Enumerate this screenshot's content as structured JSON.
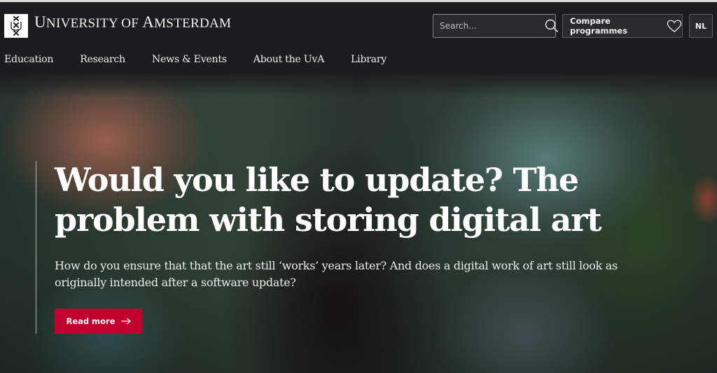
{
  "header": {
    "brand": {
      "first": "U",
      "rest1": "NIVERSITY OF ",
      "second": "A",
      "rest2": "MSTERDAM",
      "full": "University of Amsterdam"
    },
    "logo_icon": "uva-crest-icon",
    "search": {
      "placeholder": "Search...",
      "value": "",
      "icon": "search-icon"
    },
    "compare": {
      "label": "Compare programmes",
      "icon": "heart-icon"
    },
    "language": {
      "label": "NL"
    }
  },
  "nav": {
    "items": [
      {
        "label": "Education"
      },
      {
        "label": "Research"
      },
      {
        "label": "News & Events"
      },
      {
        "label": "About the UvA"
      },
      {
        "label": "Library"
      }
    ]
  },
  "hero": {
    "title": "Would you like to update? The problem with storing digital art",
    "lede": "How do you ensure that that the art still ‘works’ years later? And does a digital work of art still look as originally intended after a software update?",
    "cta": {
      "label": "Read more",
      "icon": "arrow-right-icon"
    },
    "colors": {
      "cta": "#c20030",
      "header_bg": "#1c1c1e"
    }
  }
}
